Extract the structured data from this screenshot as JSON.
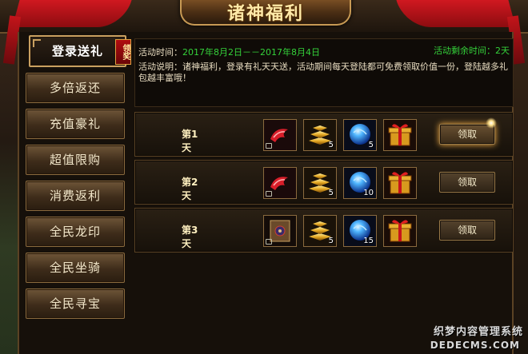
{
  "panel": {
    "title": "诸神福利"
  },
  "sidebar": {
    "items": [
      {
        "label": "登录送礼",
        "badge": "领奖"
      },
      {
        "label": "多倍返还"
      },
      {
        "label": "充值豪礼"
      },
      {
        "label": "超值限购"
      },
      {
        "label": "消费返利"
      },
      {
        "label": "全民龙印"
      },
      {
        "label": "全民坐骑"
      },
      {
        "label": "全民寻宝"
      }
    ]
  },
  "info": {
    "time_label": "活动时间：",
    "time_value": "2017年8月2日－－2017年8月4日",
    "remaining": "活动剩余时间：2天",
    "desc_label": "活动说明：",
    "desc_text": "诸神福利，登录有礼天天送，活动期间每天登陆都可免费领取价值一份，登陆越多礼包越丰富哦！"
  },
  "rows": [
    {
      "day": "第1天",
      "items": [
        {
          "icon": "red-wing-icon",
          "qty": ""
        },
        {
          "icon": "gold-bars-icon",
          "qty": "5"
        },
        {
          "icon": "blue-orb-icon",
          "qty": "5"
        },
        {
          "icon": "gift-box-icon",
          "qty": ""
        }
      ],
      "button": "领取"
    },
    {
      "day": "第2天",
      "items": [
        {
          "icon": "red-wing-icon",
          "qty": ""
        },
        {
          "icon": "gold-bars-icon",
          "qty": "5"
        },
        {
          "icon": "blue-orb-icon",
          "qty": "10"
        },
        {
          "icon": "gift-box-icon",
          "qty": ""
        }
      ],
      "button": "领取"
    },
    {
      "day": "第3天",
      "items": [
        {
          "icon": "book-icon",
          "qty": ""
        },
        {
          "icon": "gold-bars-icon",
          "qty": "5"
        },
        {
          "icon": "blue-orb-icon",
          "qty": "15"
        },
        {
          "icon": "gift-box-icon",
          "qty": ""
        }
      ],
      "button": "领取"
    }
  ],
  "watermark": {
    "cn": "织梦内容管理系统",
    "en": "DEDECMS.COM"
  }
}
